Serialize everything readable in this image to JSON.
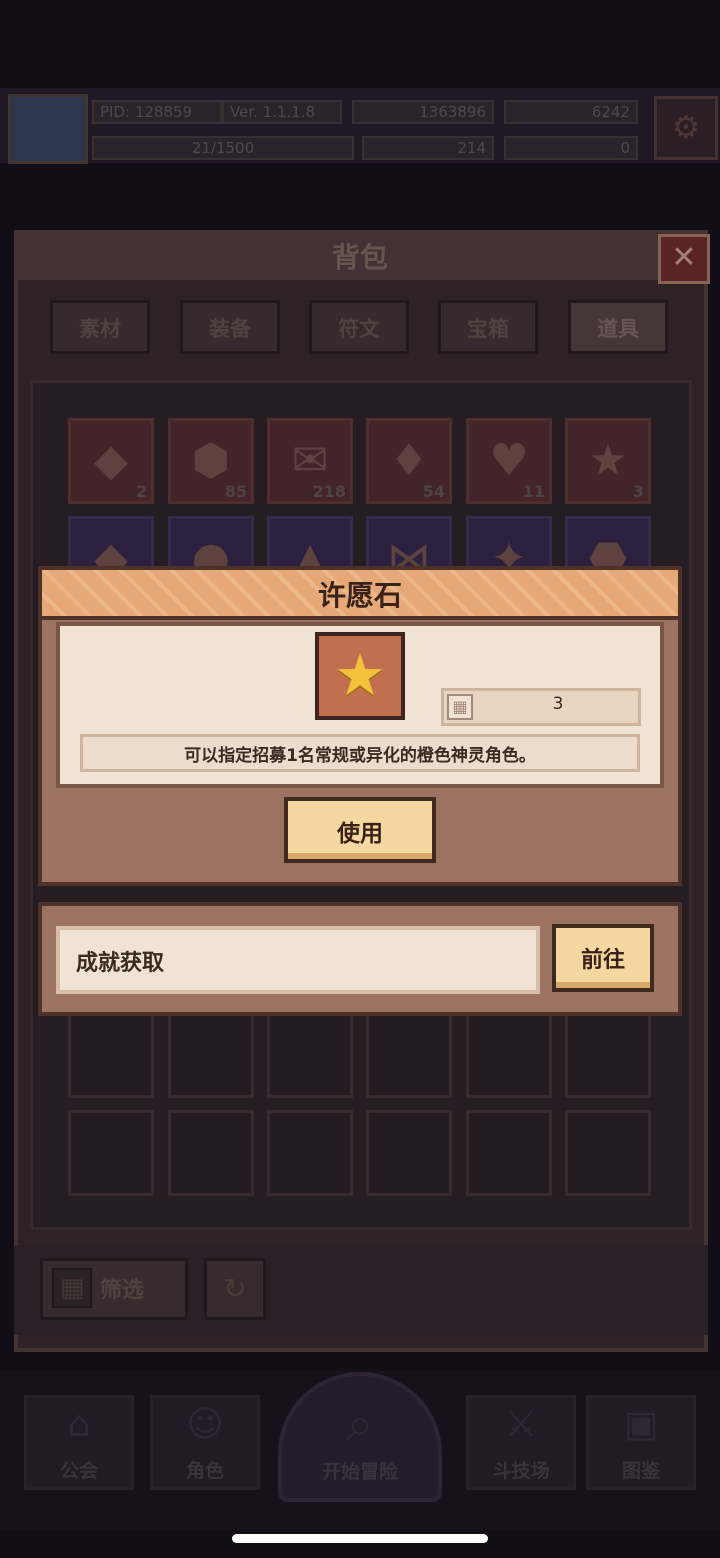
{
  "status": {
    "pid": "PID: 128859",
    "version": "Ver. 1.1.1.8",
    "gold": "1363896",
    "gems": "6242",
    "exp": "21/1500",
    "clover": "214",
    "keys": "0"
  },
  "bag": {
    "title": "背包",
    "close_icon": "close-icon",
    "tabs": [
      "素材",
      "装备",
      "符文",
      "宝箱",
      "道具"
    ],
    "active_tab": "道具",
    "items_row1": [
      {
        "icon": "red-gem-icon",
        "count": "2"
      },
      {
        "icon": "gold-gem-icon",
        "count": "85"
      },
      {
        "icon": "letter-icon",
        "count": "218"
      },
      {
        "icon": "crystal-icon",
        "count": "54"
      },
      {
        "icon": "heart-icon",
        "count": "11"
      },
      {
        "icon": "star-icon",
        "count": "3"
      }
    ],
    "filter_label": "筛选"
  },
  "nav": {
    "items": [
      "公会",
      "角色",
      "开始冒险",
      "斗技场",
      "图鉴"
    ]
  },
  "popup": {
    "title": "许愿石",
    "item_icon": "star-icon",
    "count": "3",
    "description": "可以指定招募1名常规或异化的橙色神灵角色。",
    "use_label": "使用"
  },
  "source": {
    "text": "成就获取",
    "goto_label": "前往"
  },
  "colors": {
    "popup_header": "#e6a877",
    "popup_body": "#f1e3d3",
    "button": "#f5d7a0",
    "panel": "#9c7360"
  }
}
